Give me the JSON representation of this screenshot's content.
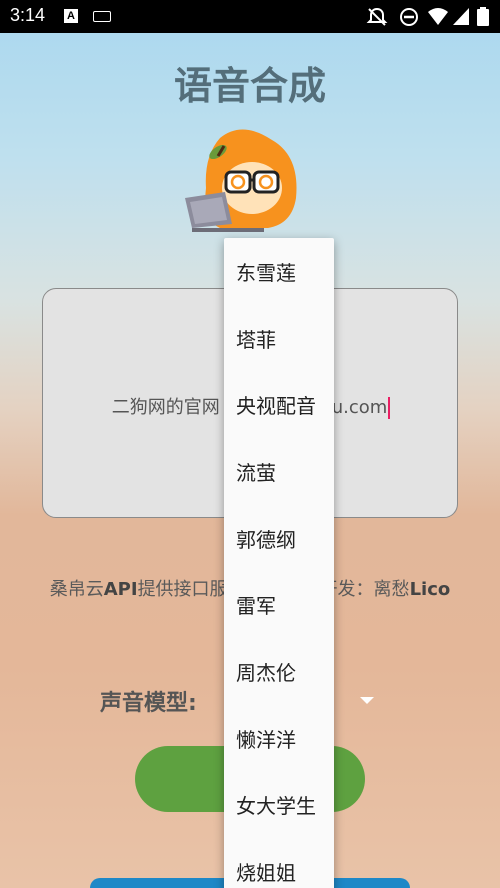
{
  "status_bar": {
    "time": "3:14",
    "icons": [
      "a-notification-icon",
      "keyboard-icon",
      "do-not-disturb-off-icon",
      "minus-circle-icon",
      "wifi-icon",
      "signal-icon",
      "battery-icon"
    ]
  },
  "page": {
    "title": "语音合成",
    "text_input_value": "二狗网的官网",
    "text_input_value_tail": "u.com",
    "credits_prefix": "桑帛云",
    "credits_api": "API",
    "credits_mid": "提供接口服",
    "credits_gap": "",
    "credits_suffix": "开发：离愁",
    "credits_author": "Lico",
    "voice_model_label": "声音模型:"
  },
  "dropdown": {
    "options": [
      "东雪莲",
      "塔菲",
      "央视配音",
      "流萤",
      "郭德纲",
      "雷军",
      "周杰伦",
      "懒洋洋",
      "女大学生",
      "烧姐姐"
    ]
  },
  "colors": {
    "title": "#546e7a",
    "primary_button": "#5ea140",
    "secondary_button": "#1e88c7",
    "cursor": "#e91e63"
  }
}
